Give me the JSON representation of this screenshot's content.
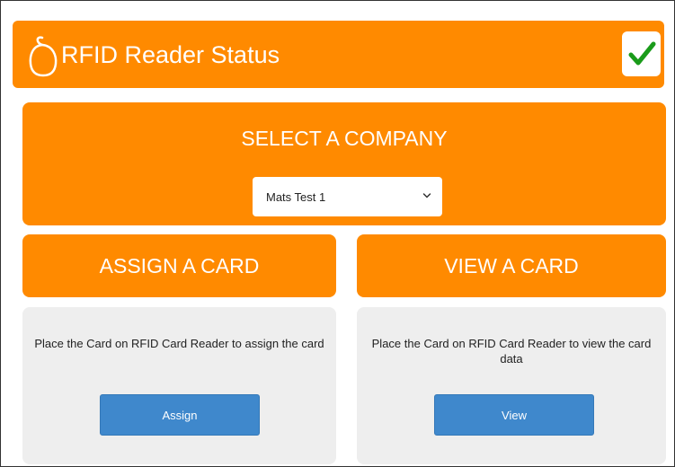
{
  "header": {
    "title": "RFID Reader Status",
    "icon": "rfid-reader-icon",
    "status_icon": "checkmark-icon",
    "status_color": "#1a9b1a",
    "accent_color": "#ff8a00"
  },
  "company": {
    "heading": "SELECT A COMPANY",
    "selected": "Mats Test 1"
  },
  "assign": {
    "heading": "ASSIGN A CARD",
    "description": "Place the Card on RFID Card Reader to assign the card",
    "button_label": "Assign",
    "button_color": "#3f88cc"
  },
  "view": {
    "heading": "VIEW A CARD",
    "description": "Place the Card on RFID Card Reader to view the card data",
    "button_label": "View",
    "button_color": "#3f88cc"
  }
}
